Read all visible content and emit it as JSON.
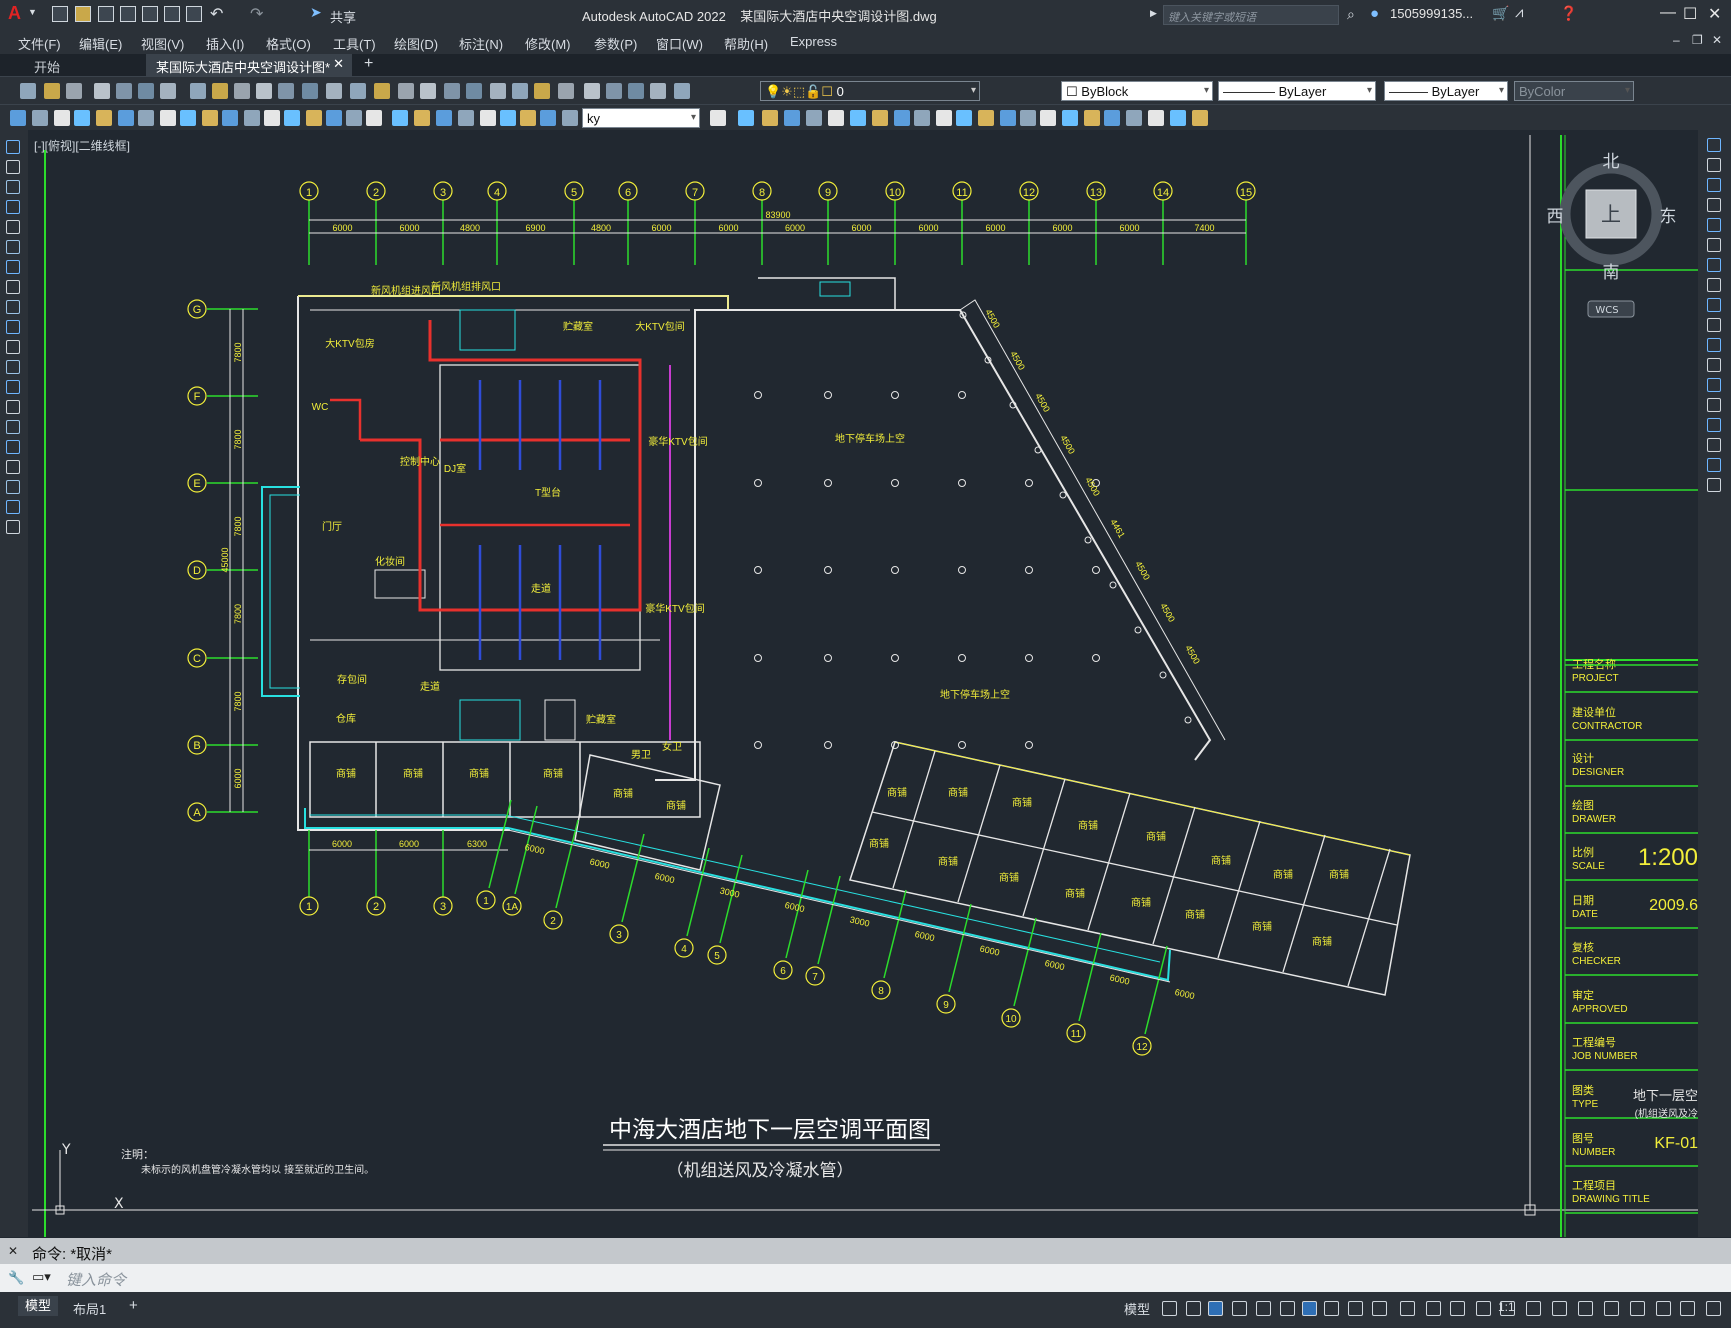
{
  "app": {
    "title": "Autodesk AutoCAD 2022    某国际大酒店中央空调设计图.dwg",
    "share_label": "共享",
    "search_placeholder": "键入关键字或短语",
    "user": "1505999135...",
    "logo": "A"
  },
  "menu": [
    "文件(F)",
    "编辑(E)",
    "视图(V)",
    "插入(I)",
    "格式(O)",
    "工具(T)",
    "绘图(D)",
    "标注(N)",
    "修改(M)",
    "参数(P)",
    "窗口(W)",
    "帮助(H)",
    "Express"
  ],
  "tabs": {
    "start": "开始",
    "file": "某国际大酒店中央空调设计图*",
    "add": "+"
  },
  "toolbar": {
    "layer_value": "0",
    "color": "ByBlock",
    "linetype": "ByLayer",
    "lineweight": "ByLayer",
    "plotstyle": "ByColor",
    "text_style": "ky"
  },
  "viewport_label": "[-][俯视][二维线框]",
  "viewcube": {
    "north": "北",
    "south": "南",
    "east": "东",
    "west": "西",
    "top": "上",
    "wcs": "WCS"
  },
  "drawing": {
    "title": "中海大酒店地下一层空调平面图",
    "subtitle": "（机组送风及冷凝水管）",
    "note_title": "注明：",
    "note_text": "未标示的风机盘管冷凝水管均以 接至就近的卫生间。",
    "total_dim": "83900",
    "top_axes": [
      "1",
      "2",
      "3",
      "4",
      "5",
      "6",
      "7",
      "8",
      "9",
      "10",
      "11",
      "12",
      "13",
      "14",
      "15"
    ],
    "top_dims": [
      "6000",
      "6000",
      "4800",
      "6900",
      "4800",
      "6000",
      "6000",
      "6000",
      "6000",
      "6000",
      "6000",
      "6000",
      "6000",
      "7400"
    ],
    "left_axes": [
      "G",
      "F",
      "E",
      "D",
      "C",
      "B",
      "A"
    ],
    "left_dims": [
      "7800",
      "7800",
      "7800",
      "7800",
      "7800",
      "6000"
    ],
    "left_total": "45000",
    "bottom_axes": [
      "1",
      "2",
      "3"
    ],
    "bottom_dims": [
      "6000",
      "6000",
      "6300"
    ],
    "skew_axes": [
      "1",
      "1A",
      "2",
      "3",
      "4",
      "5",
      "6",
      "7",
      "8",
      "9",
      "10",
      "11",
      "12"
    ],
    "skew_dims": [
      "6000",
      "6000",
      "6000",
      "3000",
      "6000",
      "3000",
      "6000",
      "6000",
      "6000",
      "6000",
      "6000"
    ],
    "right_dims": [
      "4500",
      "4500",
      "4500",
      "4500",
      "4500",
      "4461",
      "4500",
      "4500",
      "4500"
    ],
    "rooms": {
      "ktv_big": "大KTV包房",
      "storage": "贮藏室",
      "ktv_big2": "大KTV包间",
      "deluxe1": "豪华KTV包间",
      "deluxe2": "豪华KTV包间",
      "control": "控制中心",
      "dj": "DJ室",
      "stage": "T型台",
      "hall": "门厅",
      "makeup": "化妆间",
      "corridor": "走道",
      "corridor2": "走道",
      "store_bag": "存包间",
      "warehouse": "仓库",
      "storage2": "贮藏室",
      "male_wc": "男卫",
      "female_wc": "女卫",
      "wc": "WC",
      "parking1": "地下停车场上空",
      "parking2": "地下停车场上空",
      "shop": "商铺",
      "inlet": "新风机组进风口",
      "exhaust": "新风机组排风口"
    },
    "title_block": {
      "project": "工程名称\nPROJECT",
      "contractor": "建设单位\nCONTRACTOR",
      "designer": "设计\nDESIGNER",
      "drawer": "绘图\nDRAWER",
      "scale_label": "比例\nSCALE",
      "scale": "1:200",
      "date_label": "日期\nDATE",
      "date": "2009.6",
      "checker": "复核\nCHECKER",
      "approved": "审定\nAPPROVED",
      "job": "工程编号\nJOB NUMBER",
      "type_label": "图类\nTYPE",
      "type_value": "地下一层空",
      "type_sub": "(机组送风及冷",
      "number_label": "图号\nNUMBER",
      "number": "KF-01",
      "drawing_title": "工程项目\nDRAWING TITLE"
    }
  },
  "command": {
    "history": "命令: *取消*",
    "placeholder": "键入命令"
  },
  "status": {
    "model_tab": "模型",
    "layout_tab": "布局1",
    "add": "+",
    "model_btn": "模型",
    "scale": "1:1"
  },
  "colors": {
    "accent_red": "#e8312d",
    "grid_green": "#2cdc2c",
    "cyan": "#28e0e0",
    "yellow": "#f2ee3a",
    "magenta": "#c83cd0",
    "bg": "#212830"
  }
}
